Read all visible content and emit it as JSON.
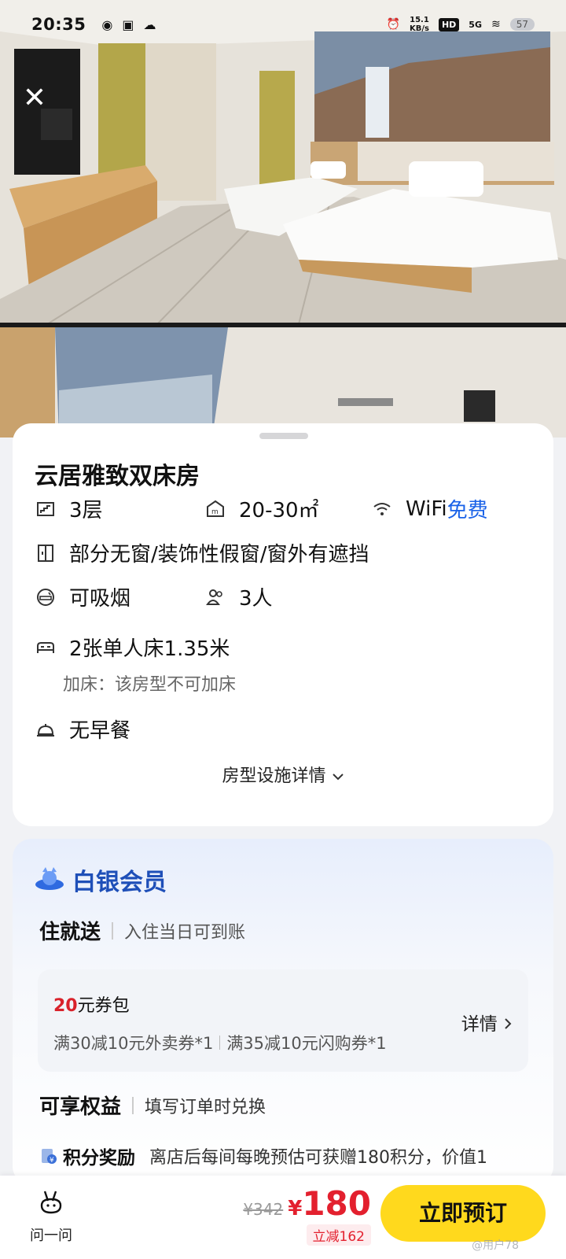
{
  "status_bar": {
    "time": "20:35",
    "net_speed": "15.1",
    "net_speed_unit": "KB/s",
    "hd": "HD",
    "signal": "5G",
    "battery": "57"
  },
  "close_icon": "close-icon",
  "room": {
    "title": "云居雅致双床房",
    "floor": "3层",
    "area": "20-30㎡",
    "wifi_label": "WiFi",
    "wifi_value": "免费",
    "window": "部分无窗/装饰性假窗/窗外有遮挡",
    "smoking": "可吸烟",
    "guests": "3人",
    "bed": "2张单人床1.35米",
    "extra_bed": "加床：该房型不可加床",
    "breakfast": "无早餐",
    "facilities_link": "房型设施详情",
    "chevron": "chevron-down-icon"
  },
  "member": {
    "title": "白银会员",
    "gift_heading": "住就送",
    "gift_desc": "入住当日可到账",
    "coupon": {
      "amount": "20",
      "amount_suffix": "元券包",
      "item1": "满30减10元外卖券*1",
      "item2": "满35减10元闪购券*1",
      "detail_label": "详情"
    },
    "benefits_heading": "可享权益",
    "benefits_desc": "填写订单时兑换",
    "points_heading": "积分奖励",
    "points_desc": "离店后每间每晚预估可获赠180积分，价值1"
  },
  "bottom_bar": {
    "ask_label": "问一问",
    "old_price": "¥342",
    "currency": "¥",
    "price": "180",
    "discount": "立减162",
    "book_label": "立即预订",
    "watermark": "@用户78"
  },
  "colors": {
    "accent_blue": "#1a62e8",
    "member_blue": "#1e4fb8",
    "price_red": "#e3202e",
    "book_yellow": "#ffd91d"
  }
}
